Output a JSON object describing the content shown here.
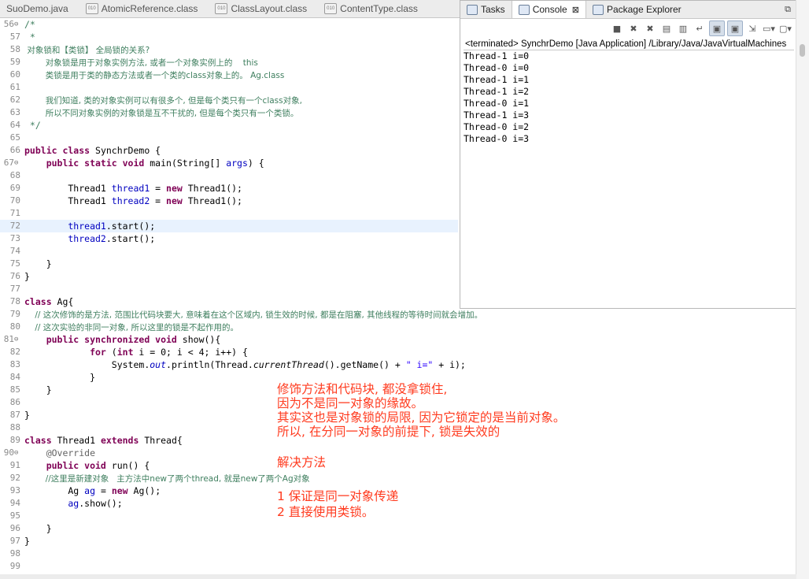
{
  "editor_tabs": [
    {
      "label": "SuoDemo.java",
      "type": "java"
    },
    {
      "label": "AtomicReference.class",
      "type": "class"
    },
    {
      "label": "ClassLayout.class",
      "type": "class"
    },
    {
      "label": "ContentType.class",
      "type": "class"
    }
  ],
  "code_lines": [
    {
      "n": "56",
      "fold": "⊖",
      "segs": [
        {
          "t": "/*",
          "c": "cm"
        }
      ]
    },
    {
      "n": "57",
      "segs": [
        {
          "t": " *",
          "c": "cm"
        }
      ]
    },
    {
      "n": "58",
      "segs": [
        {
          "t": " 对象锁和【类锁】 全局锁的关系?",
          "c": "cm cjk"
        }
      ]
    },
    {
      "n": "59",
      "segs": [
        {
          "t": "        对象锁是用于对象实例方法, 或者一个对象实例上的    this",
          "c": "cm cjk"
        }
      ]
    },
    {
      "n": "60",
      "segs": [
        {
          "t": "        类锁是用于类的静态方法或者一个类的class对象上的。 Ag.class",
          "c": "cm cjk"
        }
      ]
    },
    {
      "n": "61",
      "segs": []
    },
    {
      "n": "62",
      "segs": [
        {
          "t": "        我们知道, 类的对象实例可以有很多个, 但是每个类只有一个class对象,",
          "c": "cm cjk"
        }
      ]
    },
    {
      "n": "63",
      "segs": [
        {
          "t": "        所以不同对象实例的对象锁是互不干扰的, 但是每个类只有一个类锁。",
          "c": "cm cjk"
        }
      ]
    },
    {
      "n": "64",
      "segs": [
        {
          "t": " */",
          "c": "cm"
        }
      ]
    },
    {
      "n": "65",
      "segs": []
    },
    {
      "n": "66",
      "segs": [
        {
          "t": "public class ",
          "c": "kw"
        },
        {
          "t": "SynchrDemo {",
          "c": ""
        }
      ]
    },
    {
      "n": "67",
      "fold": "⊖",
      "segs": [
        {
          "t": "    public static void ",
          "c": "kw"
        },
        {
          "t": "main(String[] ",
          "c": ""
        },
        {
          "t": "args",
          "c": "var"
        },
        {
          "t": ") {",
          "c": ""
        }
      ]
    },
    {
      "n": "68",
      "segs": []
    },
    {
      "n": "69",
      "segs": [
        {
          "t": "        Thread1 ",
          "c": ""
        },
        {
          "t": "thread1",
          "c": "var"
        },
        {
          "t": " = ",
          "c": ""
        },
        {
          "t": "new ",
          "c": "kw"
        },
        {
          "t": "Thread1();",
          "c": ""
        }
      ]
    },
    {
      "n": "70",
      "segs": [
        {
          "t": "        Thread1 ",
          "c": ""
        },
        {
          "t": "thread2",
          "c": "var"
        },
        {
          "t": " = ",
          "c": ""
        },
        {
          "t": "new ",
          "c": "kw"
        },
        {
          "t": "Thread1();",
          "c": ""
        }
      ]
    },
    {
      "n": "71",
      "segs": []
    },
    {
      "n": "72",
      "hl": true,
      "segs": [
        {
          "t": "        thread1",
          "c": "var"
        },
        {
          "t": ".start();",
          "c": ""
        }
      ]
    },
    {
      "n": "73",
      "segs": [
        {
          "t": "        thread2",
          "c": "var"
        },
        {
          "t": ".start();",
          "c": ""
        }
      ]
    },
    {
      "n": "74",
      "segs": []
    },
    {
      "n": "75",
      "segs": [
        {
          "t": "    }",
          "c": ""
        }
      ]
    },
    {
      "n": "76",
      "segs": [
        {
          "t": "}",
          "c": ""
        }
      ]
    },
    {
      "n": "77",
      "segs": []
    },
    {
      "n": "78",
      "segs": [
        {
          "t": "class ",
          "c": "kw"
        },
        {
          "t": "Ag{",
          "c": ""
        }
      ]
    },
    {
      "n": "79",
      "segs": [
        {
          "t": "    // 这次修饰的是方法, 范围比代码块要大, 意味着在这个区域内, 锁生效的时候, 都是在阻塞, 其他线程的等待时间就会增加。",
          "c": "cm cjk"
        }
      ]
    },
    {
      "n": "80",
      "segs": [
        {
          "t": "    // 这次实验的非同一对象, 所以这里的锁是不起作用的。",
          "c": "cm cjk"
        }
      ]
    },
    {
      "n": "81",
      "fold": "⊖",
      "segs": [
        {
          "t": "    public synchronized void ",
          "c": "kw"
        },
        {
          "t": "show(){",
          "c": ""
        }
      ]
    },
    {
      "n": "82",
      "segs": [
        {
          "t": "            for ",
          "c": "kw"
        },
        {
          "t": "(",
          "c": ""
        },
        {
          "t": "int ",
          "c": "kw"
        },
        {
          "t": "i = 0; i < 4; i++) {",
          "c": ""
        }
      ]
    },
    {
      "n": "83",
      "segs": [
        {
          "t": "                System.",
          "c": ""
        },
        {
          "t": "out",
          "c": "var it"
        },
        {
          "t": ".println(Thread.",
          "c": ""
        },
        {
          "t": "currentThread",
          "c": "it"
        },
        {
          "t": "().getName() + ",
          "c": ""
        },
        {
          "t": "\" i=\"",
          "c": "st"
        },
        {
          "t": " + i);",
          "c": ""
        }
      ]
    },
    {
      "n": "84",
      "segs": [
        {
          "t": "            }",
          "c": ""
        }
      ]
    },
    {
      "n": "85",
      "segs": [
        {
          "t": "    }",
          "c": ""
        }
      ]
    },
    {
      "n": "86",
      "segs": []
    },
    {
      "n": "87",
      "segs": [
        {
          "t": "}",
          "c": ""
        }
      ]
    },
    {
      "n": "88",
      "segs": []
    },
    {
      "n": "89",
      "segs": [
        {
          "t": "class ",
          "c": "kw"
        },
        {
          "t": "Thread1 ",
          "c": ""
        },
        {
          "t": "extends ",
          "c": "kw"
        },
        {
          "t": "Thread{",
          "c": ""
        }
      ]
    },
    {
      "n": "90",
      "fold": "⊖",
      "segs": [
        {
          "t": "    @Override",
          "c": "an"
        }
      ]
    },
    {
      "n": "91",
      "segs": [
        {
          "t": "    public void ",
          "c": "kw"
        },
        {
          "t": "run() {",
          "c": ""
        }
      ]
    },
    {
      "n": "92",
      "segs": [
        {
          "t": "        //这里是新建对象   主方法中new了两个thread, 就是new了两个Ag对象",
          "c": "cm cjk"
        }
      ]
    },
    {
      "n": "93",
      "segs": [
        {
          "t": "        Ag ",
          "c": ""
        },
        {
          "t": "ag",
          "c": "var"
        },
        {
          "t": " = ",
          "c": ""
        },
        {
          "t": "new ",
          "c": "kw"
        },
        {
          "t": "Ag();",
          "c": ""
        }
      ]
    },
    {
      "n": "94",
      "segs": [
        {
          "t": "        ag",
          "c": "var"
        },
        {
          "t": ".show();",
          "c": ""
        }
      ]
    },
    {
      "n": "95",
      "segs": []
    },
    {
      "n": "96",
      "segs": [
        {
          "t": "    }",
          "c": ""
        }
      ]
    },
    {
      "n": "97",
      "segs": [
        {
          "t": "}",
          "c": ""
        }
      ]
    },
    {
      "n": "98",
      "segs": []
    },
    {
      "n": "99",
      "segs": []
    }
  ],
  "console": {
    "tabs": [
      {
        "label": "Tasks",
        "active": false
      },
      {
        "label": "Console",
        "active": true,
        "close": "⊠"
      },
      {
        "label": "Package Explorer",
        "active": false
      }
    ],
    "status": "<terminated> SynchrDemo [Java Application] /Library/Java/JavaVirtualMachines",
    "output": [
      "Thread-1 i=0",
      "Thread-0 i=0",
      "Thread-1 i=1",
      "Thread-1 i=2",
      "Thread-0 i=1",
      "Thread-1 i=3",
      "Thread-0 i=2",
      "Thread-0 i=3"
    ]
  },
  "annotations": [
    "修饰方法和代码块, 都没拿锁住,",
    "因为不是同一对象的缘故。",
    "其实这也是对象锁的局限, 因为它锁定的是当前对象。",
    "所以, 在分同一对象的前提下, 锁是失效的",
    "解决方法",
    "1 保证是同一对象传递",
    "2 直接使用类锁。"
  ],
  "colors": {
    "annotation": "#ff3b1f",
    "keyword": "#7f0055",
    "comment": "#3f7f5f",
    "string": "#2a00ff"
  }
}
